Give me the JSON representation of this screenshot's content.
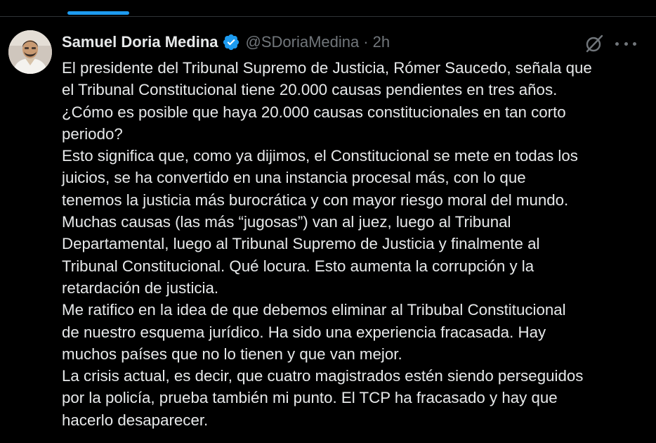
{
  "colors": {
    "background": "#000000",
    "text_primary": "#e7e9ea",
    "text_secondary": "#71767b",
    "accent": "#1d9bf0"
  },
  "tweet": {
    "author": {
      "display_name": "Samuel Doria Medina",
      "handle": "@SDoriaMedina",
      "verified_icon": "verified-badge-icon",
      "avatar": "avatar-photo"
    },
    "separator": "·",
    "timestamp": "2h",
    "icons": [
      "grok-icon",
      "more-options-icon"
    ],
    "text_lines": [
      "El presidente del Tribunal Supremo de Justicia, Rómer Saucedo, señala que",
      "el Tribunal Constitucional tiene 20.000 causas pendientes en tres años.",
      "¿Cómo es posible que haya 20.000 causas constitucionales en tan corto",
      "periodo?",
      "Esto significa que, como ya dijimos, el Constitucional se mete en todas los",
      "juicios, se ha convertido en una instancia procesal más, con lo que",
      "tenemos la justicia más burocrática y con mayor riesgo moral del mundo.",
      "Muchas causas (las más “jugosas”) van al juez, luego al Tribunal",
      "Departamental, luego al Tribunal Supremo de Justicia y finalmente al",
      "Tribunal Constitucional. Qué locura. Esto aumenta la corrupción y la",
      "retardación de justicia.",
      "Me ratifico en la idea de que debemos eliminar al Tribubal Constitucional",
      "de nuestro esquema jurídico. Ha sido una experiencia fracasada. Hay",
      "muchos países que no lo tienen y que van mejor.",
      "La crisis actual, es decir, que cuatro magistrados estén siendo perseguidos",
      "por la policía, prueba también mi punto. El TCP ha fracasado y hay que",
      "hacerlo desaparecer."
    ]
  }
}
